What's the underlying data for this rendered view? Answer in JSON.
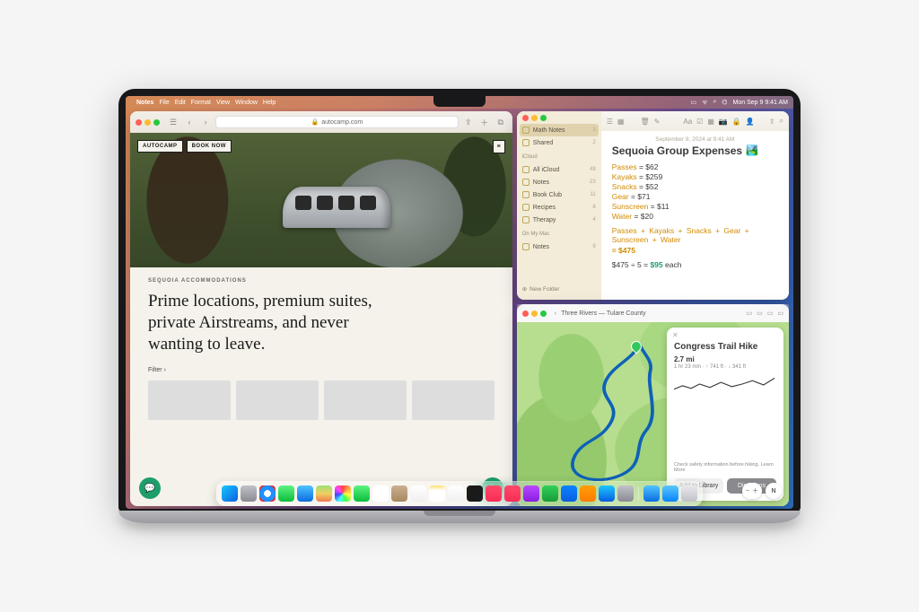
{
  "menubar": {
    "appname": "Notes",
    "items": [
      "File",
      "Edit",
      "Format",
      "View",
      "Window",
      "Help"
    ],
    "datetime": "Mon Sep 9  9:41 AM"
  },
  "safari": {
    "url": "autocamp.com",
    "hero_badge_logo": "AUTOCAMP",
    "hero_badge_cta": "BOOK NOW",
    "eyebrow": "SEQUOIA ACCOMMODATIONS",
    "headline": "Prime locations, premium suites, private Airstreams, and never wanting to leave.",
    "filter": "Filter ›"
  },
  "notes": {
    "sidebar_sections": [
      {
        "head": null,
        "rows": [
          {
            "label": "Math Notes",
            "count": "3",
            "sel": true
          },
          {
            "label": "Shared",
            "count": "2"
          }
        ]
      },
      {
        "head": "iCloud",
        "rows": [
          {
            "label": "All iCloud",
            "count": "49"
          },
          {
            "label": "Notes",
            "count": "23"
          },
          {
            "label": "Book Club",
            "count": "11"
          },
          {
            "label": "Recipes",
            "count": "8"
          },
          {
            "label": "Therapy",
            "count": "4"
          }
        ]
      },
      {
        "head": "On My Mac",
        "rows": [
          {
            "label": "Notes",
            "count": "9"
          }
        ]
      }
    ],
    "new_folder": "New Folder",
    "note_date": "September 8, 2024 at 9:41 AM",
    "note_title": "Sequoia Group Expenses",
    "expenses": [
      {
        "k": "Passes",
        "v": "$62"
      },
      {
        "k": "Kayaks",
        "v": "$259"
      },
      {
        "k": "Snacks",
        "v": "$52"
      },
      {
        "k": "Gear",
        "v": "$71"
      },
      {
        "k": "Sunscreen",
        "v": "$11"
      },
      {
        "k": "Water",
        "v": "$20"
      }
    ],
    "sum_items": [
      "Passes",
      "Kayaks",
      "Snacks",
      "Gear",
      "Sunscreen",
      "Water"
    ],
    "sum_eq": "= $475",
    "div_expr": "$475 ÷ 5 =",
    "div_result": "$95",
    "each": " each"
  },
  "maps": {
    "location": "Three Rivers — Tulare County",
    "card": {
      "title": "Congress Trail Hike",
      "distance": "2.7 mi",
      "subline": "1 hr 23 min · ↑ 741 ft · ↓ 341 ft",
      "safety": "Check safety information before hiking. Learn More",
      "btn_lib": "Add to Library",
      "btn_dir": "Directions"
    },
    "compass": "N"
  },
  "dock_icons": [
    {
      "name": "finder",
      "bg": "linear-gradient(135deg,#1ac8ff,#0a5de0)"
    },
    {
      "name": "launchpad",
      "bg": "linear-gradient(#c0c0c8,#8a8a92)"
    },
    {
      "name": "safari",
      "bg": "radial-gradient(circle,#fff 30%,#1e90ff 31% 70%,#e03030 71%)"
    },
    {
      "name": "messages",
      "bg": "linear-gradient(#5ff281,#0bbd3b)"
    },
    {
      "name": "mail",
      "bg": "linear-gradient(#4fc3ff,#0a6de0)"
    },
    {
      "name": "maps",
      "bg": "linear-gradient(#9be07a,#f0d060 50%,#f07a50)"
    },
    {
      "name": "photos",
      "bg": "conic-gradient(#f44,#fa4,#ff4,#4f4,#4ff,#44f,#f4f,#f44)"
    },
    {
      "name": "facetime",
      "bg": "linear-gradient(#5ff281,#0bbd3b)"
    },
    {
      "name": "calendar",
      "bg": "linear-gradient(#fff,#fff)"
    },
    {
      "name": "contacts",
      "bg": "linear-gradient(#c8b090,#a88860)"
    },
    {
      "name": "reminders",
      "bg": "linear-gradient(#fff,#f0f0f0)"
    },
    {
      "name": "notes",
      "bg": "linear-gradient(#ffe070,#fff 30%)"
    },
    {
      "name": "freeform",
      "bg": "linear-gradient(#fff,#f0f0f0)"
    },
    {
      "name": "tv",
      "bg": "#1a1a1a"
    },
    {
      "name": "music",
      "bg": "linear-gradient(#ff4a6a,#fa2c55)"
    },
    {
      "name": "news",
      "bg": "linear-gradient(#ff4a6a,#fa2c55)"
    },
    {
      "name": "podcasts",
      "bg": "linear-gradient(#b84aff,#8a1ce0)"
    },
    {
      "name": "numbers",
      "bg": "linear-gradient(#30d158,#1a9a3a)"
    },
    {
      "name": "keynote",
      "bg": "linear-gradient(#0a84ff,#0a5de0)"
    },
    {
      "name": "pages",
      "bg": "linear-gradient(#ff9f0a,#ff7a00)"
    },
    {
      "name": "appstore",
      "bg": "linear-gradient(#1ac8ff,#0a5de0)"
    },
    {
      "name": "settings",
      "bg": "linear-gradient(#c0c0c8,#8a8a92)"
    },
    {
      "name": "sep"
    },
    {
      "name": "downloads",
      "bg": "linear-gradient(#4fc3ff,#0a6de0)"
    },
    {
      "name": "folder",
      "bg": "linear-gradient(#5ac8fa,#0a84ff)"
    },
    {
      "name": "trash",
      "bg": "linear-gradient(#e8e8ec,#c0c0c8)"
    }
  ]
}
